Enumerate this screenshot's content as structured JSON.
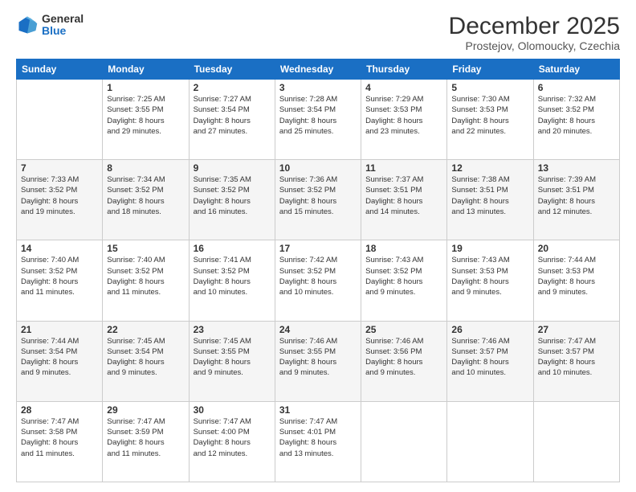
{
  "logo": {
    "general": "General",
    "blue": "Blue"
  },
  "header": {
    "month": "December 2025",
    "location": "Prostejov, Olomoucky, Czechia"
  },
  "weekdays": [
    "Sunday",
    "Monday",
    "Tuesday",
    "Wednesday",
    "Thursday",
    "Friday",
    "Saturday"
  ],
  "weeks": [
    [
      {
        "day": "",
        "info": ""
      },
      {
        "day": "1",
        "info": "Sunrise: 7:25 AM\nSunset: 3:55 PM\nDaylight: 8 hours\nand 29 minutes."
      },
      {
        "day": "2",
        "info": "Sunrise: 7:27 AM\nSunset: 3:54 PM\nDaylight: 8 hours\nand 27 minutes."
      },
      {
        "day": "3",
        "info": "Sunrise: 7:28 AM\nSunset: 3:54 PM\nDaylight: 8 hours\nand 25 minutes."
      },
      {
        "day": "4",
        "info": "Sunrise: 7:29 AM\nSunset: 3:53 PM\nDaylight: 8 hours\nand 23 minutes."
      },
      {
        "day": "5",
        "info": "Sunrise: 7:30 AM\nSunset: 3:53 PM\nDaylight: 8 hours\nand 22 minutes."
      },
      {
        "day": "6",
        "info": "Sunrise: 7:32 AM\nSunset: 3:52 PM\nDaylight: 8 hours\nand 20 minutes."
      }
    ],
    [
      {
        "day": "7",
        "info": "Sunrise: 7:33 AM\nSunset: 3:52 PM\nDaylight: 8 hours\nand 19 minutes."
      },
      {
        "day": "8",
        "info": "Sunrise: 7:34 AM\nSunset: 3:52 PM\nDaylight: 8 hours\nand 18 minutes."
      },
      {
        "day": "9",
        "info": "Sunrise: 7:35 AM\nSunset: 3:52 PM\nDaylight: 8 hours\nand 16 minutes."
      },
      {
        "day": "10",
        "info": "Sunrise: 7:36 AM\nSunset: 3:52 PM\nDaylight: 8 hours\nand 15 minutes."
      },
      {
        "day": "11",
        "info": "Sunrise: 7:37 AM\nSunset: 3:51 PM\nDaylight: 8 hours\nand 14 minutes."
      },
      {
        "day": "12",
        "info": "Sunrise: 7:38 AM\nSunset: 3:51 PM\nDaylight: 8 hours\nand 13 minutes."
      },
      {
        "day": "13",
        "info": "Sunrise: 7:39 AM\nSunset: 3:51 PM\nDaylight: 8 hours\nand 12 minutes."
      }
    ],
    [
      {
        "day": "14",
        "info": "Sunrise: 7:40 AM\nSunset: 3:52 PM\nDaylight: 8 hours\nand 11 minutes."
      },
      {
        "day": "15",
        "info": "Sunrise: 7:40 AM\nSunset: 3:52 PM\nDaylight: 8 hours\nand 11 minutes."
      },
      {
        "day": "16",
        "info": "Sunrise: 7:41 AM\nSunset: 3:52 PM\nDaylight: 8 hours\nand 10 minutes."
      },
      {
        "day": "17",
        "info": "Sunrise: 7:42 AM\nSunset: 3:52 PM\nDaylight: 8 hours\nand 10 minutes."
      },
      {
        "day": "18",
        "info": "Sunrise: 7:43 AM\nSunset: 3:52 PM\nDaylight: 8 hours\nand 9 minutes."
      },
      {
        "day": "19",
        "info": "Sunrise: 7:43 AM\nSunset: 3:53 PM\nDaylight: 8 hours\nand 9 minutes."
      },
      {
        "day": "20",
        "info": "Sunrise: 7:44 AM\nSunset: 3:53 PM\nDaylight: 8 hours\nand 9 minutes."
      }
    ],
    [
      {
        "day": "21",
        "info": "Sunrise: 7:44 AM\nSunset: 3:54 PM\nDaylight: 8 hours\nand 9 minutes."
      },
      {
        "day": "22",
        "info": "Sunrise: 7:45 AM\nSunset: 3:54 PM\nDaylight: 8 hours\nand 9 minutes."
      },
      {
        "day": "23",
        "info": "Sunrise: 7:45 AM\nSunset: 3:55 PM\nDaylight: 8 hours\nand 9 minutes."
      },
      {
        "day": "24",
        "info": "Sunrise: 7:46 AM\nSunset: 3:55 PM\nDaylight: 8 hours\nand 9 minutes."
      },
      {
        "day": "25",
        "info": "Sunrise: 7:46 AM\nSunset: 3:56 PM\nDaylight: 8 hours\nand 9 minutes."
      },
      {
        "day": "26",
        "info": "Sunrise: 7:46 AM\nSunset: 3:57 PM\nDaylight: 8 hours\nand 10 minutes."
      },
      {
        "day": "27",
        "info": "Sunrise: 7:47 AM\nSunset: 3:57 PM\nDaylight: 8 hours\nand 10 minutes."
      }
    ],
    [
      {
        "day": "28",
        "info": "Sunrise: 7:47 AM\nSunset: 3:58 PM\nDaylight: 8 hours\nand 11 minutes."
      },
      {
        "day": "29",
        "info": "Sunrise: 7:47 AM\nSunset: 3:59 PM\nDaylight: 8 hours\nand 11 minutes."
      },
      {
        "day": "30",
        "info": "Sunrise: 7:47 AM\nSunset: 4:00 PM\nDaylight: 8 hours\nand 12 minutes."
      },
      {
        "day": "31",
        "info": "Sunrise: 7:47 AM\nSunset: 4:01 PM\nDaylight: 8 hours\nand 13 minutes."
      },
      {
        "day": "",
        "info": ""
      },
      {
        "day": "",
        "info": ""
      },
      {
        "day": "",
        "info": ""
      }
    ]
  ]
}
